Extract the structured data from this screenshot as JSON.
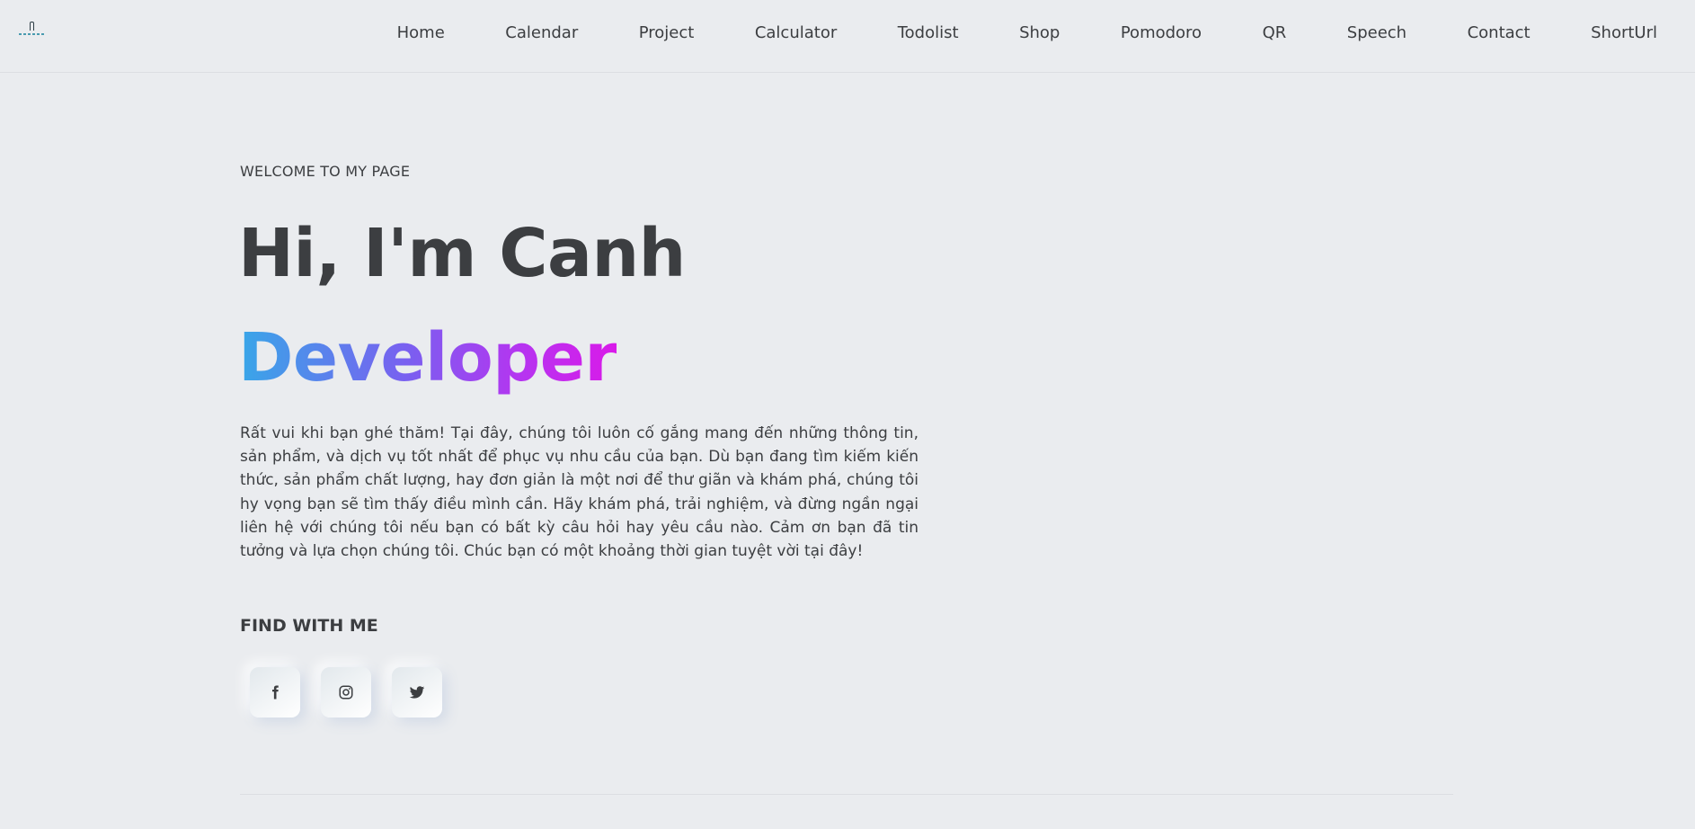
{
  "nav": {
    "items": [
      "Home",
      "Calendar",
      "Project",
      "Calculator",
      "Todolist",
      "Shop",
      "Pomodoro",
      "QR",
      "Speech",
      "Contact",
      "ShortUrl"
    ]
  },
  "hero": {
    "eyebrow": "WELCOME TO MY PAGE",
    "title": "Hi, I'm Canh",
    "role": "Developer",
    "description": "Rất vui khi bạn ghé thăm! Tại đây, chúng tôi luôn cố gắng mang đến những thông tin, sản phẩm, và dịch vụ tốt nhất để phục vụ nhu cầu của bạn. Dù bạn đang tìm kiếm kiến thức, sản phẩm chất lượng, hay đơn giản là một nơi để thư giãn và khám phá, chúng tôi hy vọng bạn sẽ tìm thấy điều mình cần. Hãy khám phá, trải nghiệm, và đừng ngần ngại liên hệ với chúng tôi nếu bạn có bất kỳ câu hỏi hay yêu cầu nào. Cảm ơn bạn đã tin tưởng và lựa chọn chúng tôi. Chúc bạn có một khoảng thời gian tuyệt vời tại đây!"
  },
  "find": {
    "heading": "FIND WITH ME",
    "socials": [
      {
        "icon": "facebook-icon"
      },
      {
        "icon": "instagram-icon"
      },
      {
        "icon": "twitter-icon"
      }
    ]
  },
  "colors": {
    "background": "#eaecef",
    "text": "#3c3e41",
    "gradient_start": "#38a7e8",
    "gradient_end": "#d91ae9"
  }
}
